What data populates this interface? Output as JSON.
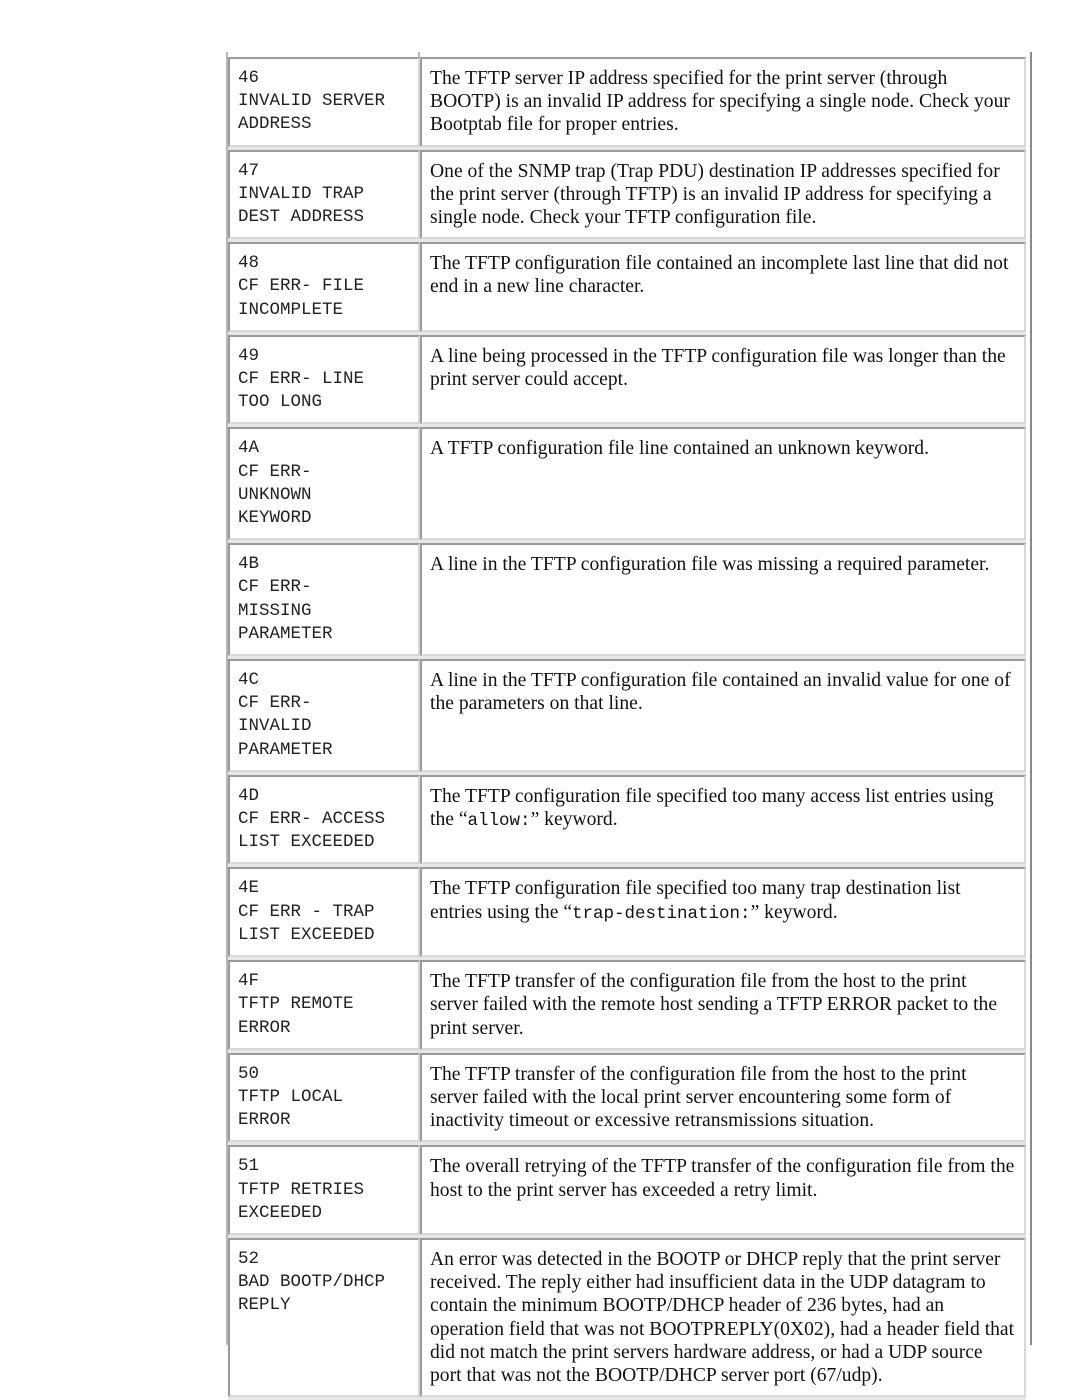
{
  "table": {
    "rows": [
      {
        "code": "46",
        "name_lines": [
          "INVALID SERVER",
          "ADDRESS"
        ],
        "desc": "The TFTP server IP address specified for the print server (through BOOTP) is an invalid IP address for specifying a single node. Check your Bootptab file for proper entries."
      },
      {
        "code": "47",
        "name_lines": [
          "INVALID TRAP",
          "DEST ADDRESS"
        ],
        "desc": "One of the SNMP trap (Trap PDU) destination IP addresses specified for the print server (through TFTP) is an invalid IP address for specifying a single node. Check your TFTP configuration file."
      },
      {
        "code": "48",
        "name_lines": [
          "CF ERR- FILE",
          "INCOMPLETE"
        ],
        "desc": "The TFTP configuration file contained an incomplete last line that did not end in a new line character."
      },
      {
        "code": "49",
        "name_lines": [
          "CF ERR- LINE",
          "TOO LONG"
        ],
        "desc": "A line being processed in the TFTP configuration file was longer than the print server could accept."
      },
      {
        "code": "4A",
        "name_lines": [
          "CF ERR-",
          "UNKNOWN",
          "KEYWORD"
        ],
        "desc": "A TFTP configuration file line contained an unknown keyword."
      },
      {
        "code": "4B",
        "name_lines": [
          "CF ERR-",
          "MISSING",
          "PARAMETER"
        ],
        "desc": "A line in the TFTP configuration file was missing a required parameter."
      },
      {
        "code": "4C",
        "name_lines": [
          "CF ERR-",
          "INVALID",
          "PARAMETER"
        ],
        "desc": "A line in the TFTP configuration file contained an invalid value for one of the parameters on that line."
      },
      {
        "code": "4D",
        "name_lines": [
          "CF ERR- ACCESS",
          "LIST EXCEEDED"
        ],
        "desc_pre": "The TFTP configuration file specified too many access list entries using the “",
        "desc_mono": "allow:",
        "desc_post": "” keyword."
      },
      {
        "code": "4E",
        "name_lines": [
          "CF ERR - TRAP",
          "LIST EXCEEDED"
        ],
        "desc_pre": "The TFTP configuration file specified too many trap destination list entries using the “",
        "desc_mono": "trap-destination:",
        "desc_post": "” keyword."
      },
      {
        "code": "4F",
        "name_lines": [
          "TFTP REMOTE",
          "ERROR"
        ],
        "desc": "The TFTP transfer of the configuration file from the host to the print server failed with the remote host sending a TFTP ERROR packet to the print server."
      },
      {
        "code": "50",
        "name_lines": [
          "TFTP LOCAL",
          "ERROR"
        ],
        "desc": "The TFTP transfer of the configuration file from the host to the print server failed with the local print server encountering some form of inactivity timeout or excessive retransmissions situation."
      },
      {
        "code": "51",
        "name_lines": [
          "TFTP RETRIES",
          "EXCEEDED"
        ],
        "desc": "The overall retrying of the TFTP transfer of the configuration file from the host to the print server has exceeded a retry limit."
      },
      {
        "code": "52",
        "name_lines": [
          "BAD BOOTP/DHCP",
          "REPLY"
        ],
        "desc": "An error was detected in the BOOTP or DHCP reply that the print server received. The reply either had insufficient data in the UDP datagram to contain the minimum BOOTP/DHCP header of 236 bytes, had an operation field that was not BOOTPREPLY(0X02), had a header field that did not match the print servers hardware address, or had a UDP source port that was not the BOOTP/DHCP server port (67/udp)."
      }
    ]
  }
}
